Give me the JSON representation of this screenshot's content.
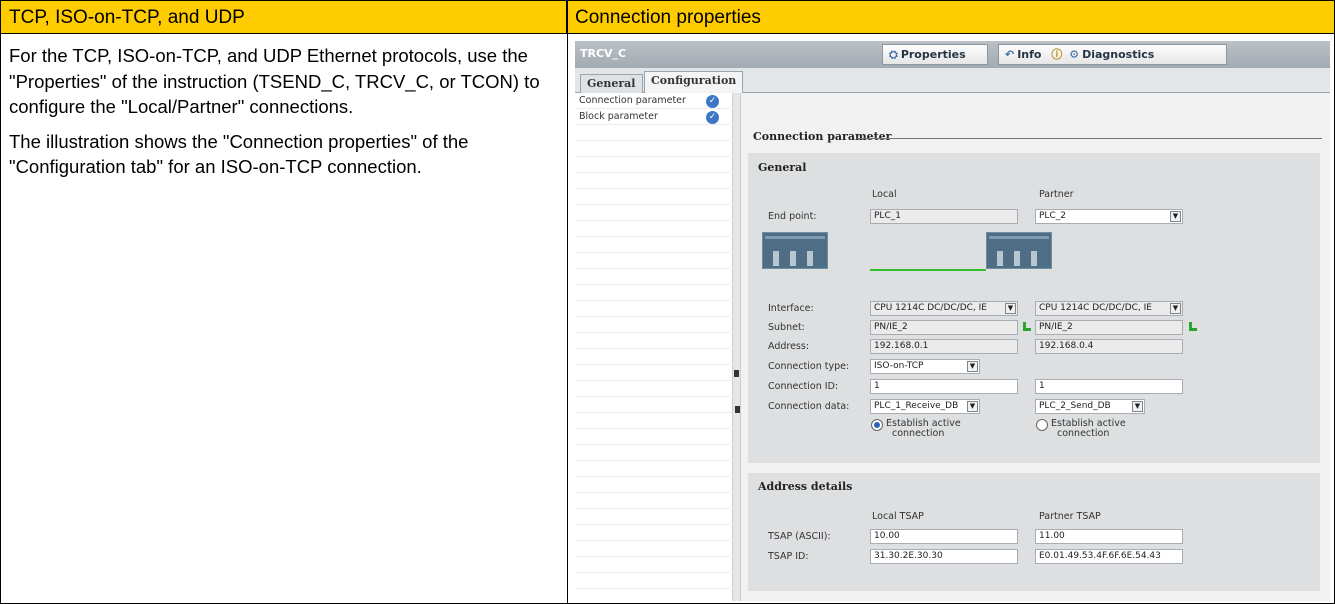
{
  "doc": {
    "left_header": "TCP, ISO-on-TCP, and UDP",
    "right_header": "Connection properties",
    "paragraph1": "For the TCP, ISO-on-TCP, and UDP Ethernet protocols, use the \"Properties\" of the instruction (TSEND_C, TRCV_C, or TCON) to configure the \"Local/Partner\" connections.",
    "paragraph2": "The illustration shows the \"Connection properties\" of the \"Configuration tab\" for an ISO-on-TCP connection."
  },
  "panel": {
    "title": "TRCV_C",
    "tabs": {
      "properties": "Properties",
      "info": "Info",
      "diagnostics": "Diagnostics"
    },
    "section_tabs": {
      "general": "General",
      "configuration": "Configuration"
    },
    "nav": [
      {
        "label": "Connection parameter"
      },
      {
        "label": "Block parameter"
      }
    ],
    "section_title": "Connection parameter",
    "general": {
      "title": "General",
      "col_local": "Local",
      "col_partner": "Partner",
      "end_point_label": "End point:",
      "local_end_point": "PLC_1",
      "partner_end_point": "PLC_2",
      "interface_label": "Interface:",
      "local_interface": "CPU 1214C DC/DC/DC, IE",
      "partner_interface": "CPU 1214C DC/DC/DC, IE",
      "subnet_label": "Subnet:",
      "local_subnet": "PN/IE_2",
      "partner_subnet": "PN/IE_2",
      "address_label": "Address:",
      "local_address": "192.168.0.1",
      "partner_address": "192.168.0.4",
      "connection_type_label": "Connection type:",
      "connection_type": "ISO-on-TCP",
      "connection_id_label": "Connection ID:",
      "local_connection_id": "1",
      "partner_connection_id": "1",
      "connection_data_label": "Connection data:",
      "local_connection_data": "PLC_1_Receive_DB",
      "partner_connection_data": "PLC_2_Send_DB",
      "local_active_line1": "Establish active",
      "local_active_line2": "connection",
      "partner_active_line1": "Establish active",
      "partner_active_line2": "connection",
      "local_active_selected": true,
      "partner_active_selected": false
    },
    "address_details": {
      "title": "Address details",
      "col_local": "Local TSAP",
      "col_partner": "Partner TSAP",
      "tsap_ascii_label": "TSAP (ASCII):",
      "local_tsap_ascii": "10.00",
      "partner_tsap_ascii": "11.00",
      "tsap_id_label": "TSAP ID:",
      "local_tsap_id": "31.30.2E.30.30",
      "partner_tsap_id": "E0.01.49.53.4F.6F.6E.54.43"
    }
  },
  "colors": {
    "header_yellow": "#ffcc00",
    "accent_blue": "#3b78c4",
    "link_green": "#30c030"
  }
}
